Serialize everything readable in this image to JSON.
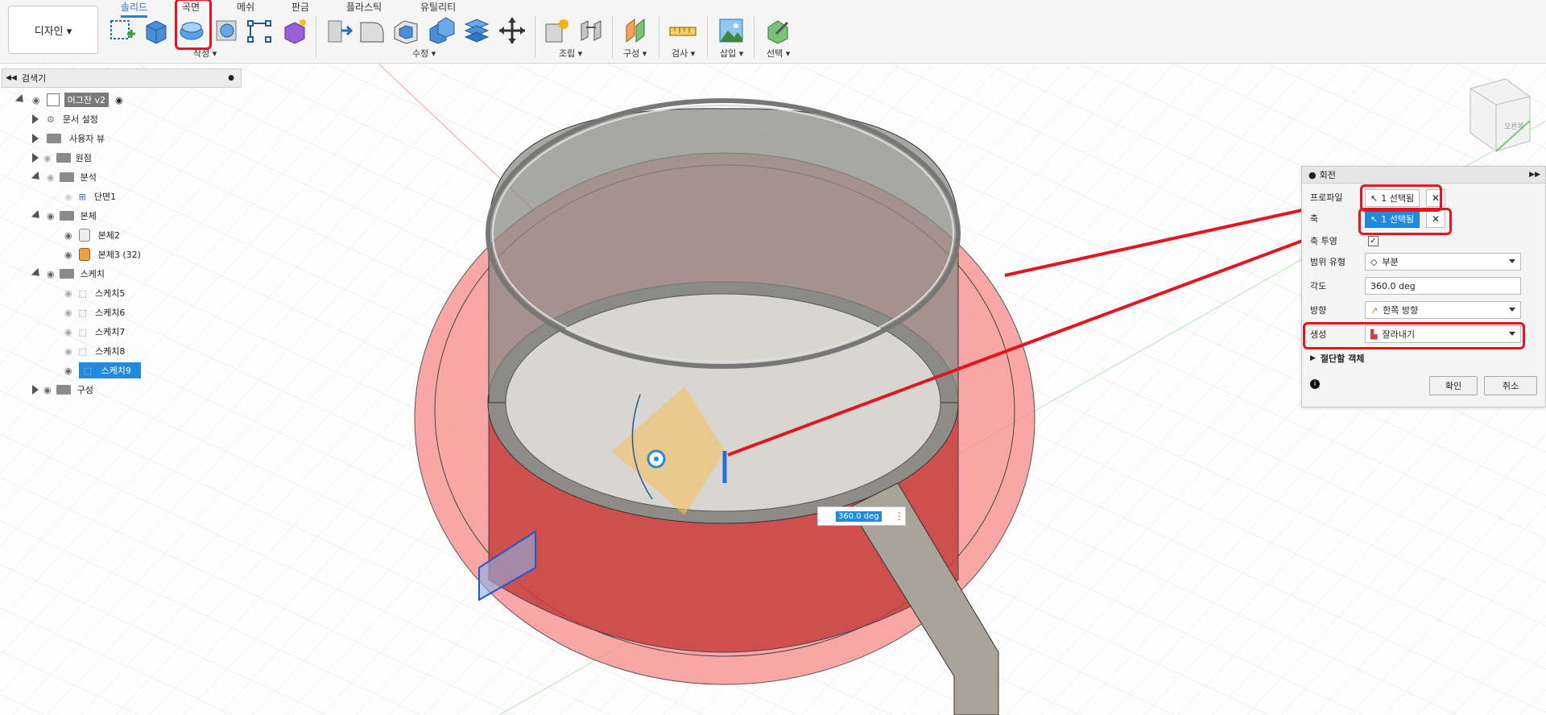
{
  "toolbar": {
    "workspace": "디자인 ▾",
    "tabs": [
      {
        "label": "솔리드",
        "active": true
      },
      {
        "label": "곡면",
        "active": false
      },
      {
        "label": "메쉬",
        "active": false
      },
      {
        "label": "판금",
        "active": false
      },
      {
        "label": "플라스틱",
        "active": false
      },
      {
        "label": "유틸리티",
        "active": false
      }
    ],
    "groups": {
      "create": "작성 ▾",
      "modify": "수정 ▾",
      "assemble": "조립 ▾",
      "construct": "구성 ▾",
      "inspect": "검사 ▾",
      "insert": "삽입 ▾",
      "select": "선택 ▾"
    }
  },
  "browser": {
    "title": "검색기",
    "root": "머그잔 v2",
    "items": [
      {
        "label": "문서 설정"
      },
      {
        "label": "사용자 뷰"
      },
      {
        "label": "원점"
      },
      {
        "label": "분석"
      },
      {
        "label": "단면1"
      },
      {
        "label": "본체"
      },
      {
        "label": "본체2"
      },
      {
        "label": "본체3 (32)"
      },
      {
        "label": "스케치"
      },
      {
        "label": "스케치5"
      },
      {
        "label": "스케치6"
      },
      {
        "label": "스케치7"
      },
      {
        "label": "스케치8"
      },
      {
        "label": "스케치9"
      },
      {
        "label": "구성"
      }
    ]
  },
  "panel": {
    "title": "회전",
    "profile_label": "프로파일",
    "profile_value": "1 선택됨",
    "axis_label": "축",
    "axis_value": "1 선택됨",
    "project_axis_label": "축 투영",
    "extent_label": "범위 유형",
    "extent_value": "부분",
    "angle_label": "각도",
    "angle_value": "360.0 deg",
    "direction_label": "방향",
    "direction_value": "한쪽 방향",
    "operation_label": "생성",
    "operation_value": "잘라내기",
    "objects_label": "절단할 객체",
    "ok": "확인",
    "cancel": "취소"
  },
  "viewport": {
    "angle_input": "360.0 deg",
    "viewcube": "오른쪽"
  },
  "colors": {
    "accent": "#1e8ae0",
    "highlight": "#e2161e",
    "body_red": "#f06060"
  }
}
